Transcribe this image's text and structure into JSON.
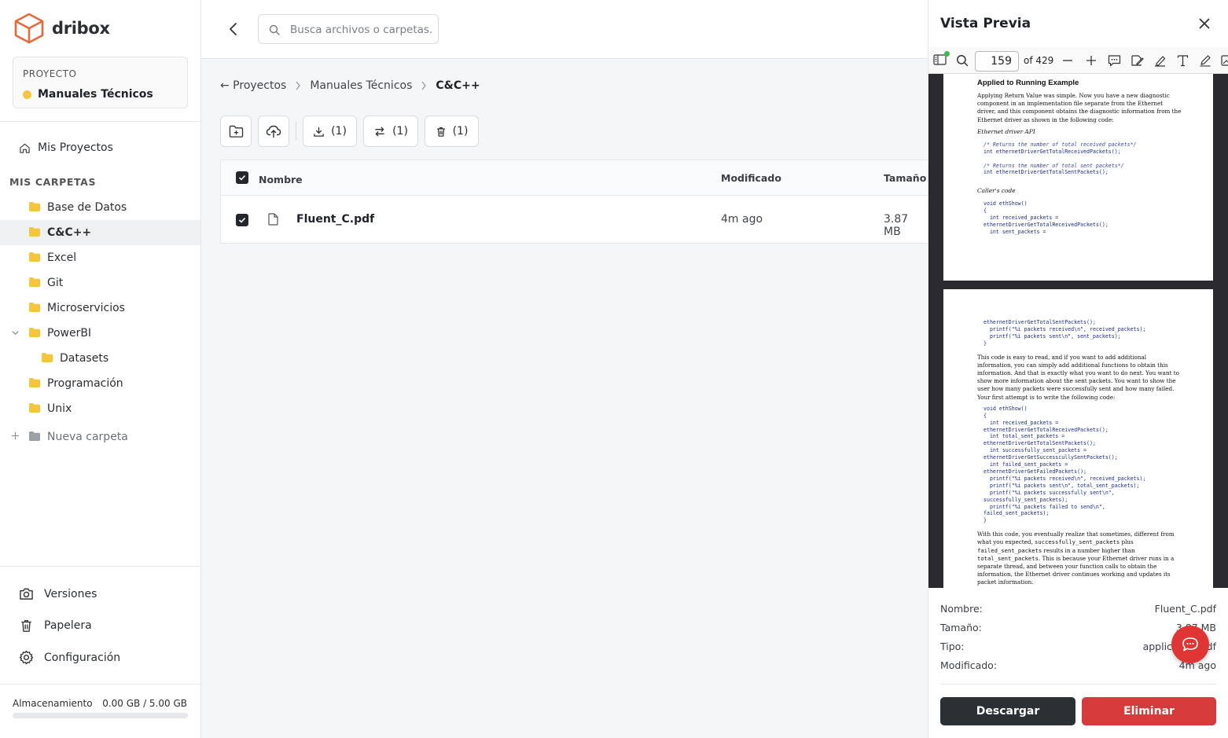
{
  "app": {
    "name": "dribox"
  },
  "project": {
    "label": "PROYECTO",
    "name": "Manuales Técnicos",
    "color": "#f5c542"
  },
  "nav": {
    "my_projects": "Mis Proyectos",
    "folders_title": "MIS CARPETAS"
  },
  "folders": [
    {
      "label": "Base de Datos"
    },
    {
      "label": "C&C++",
      "active": true
    },
    {
      "label": "Excel"
    },
    {
      "label": "Git"
    },
    {
      "label": "Microservicios"
    },
    {
      "label": "PowerBI",
      "expanded": true
    },
    {
      "label": "Datasets",
      "child": true
    },
    {
      "label": "Programación"
    },
    {
      "label": "Unix"
    }
  ],
  "new_folder": "Nueva carpeta",
  "bottom_nav": {
    "versions": "Versiones",
    "trash": "Papelera",
    "settings": "Configuración"
  },
  "storage": {
    "label": "Almacenamiento",
    "value": "0.00 GB / 5.00 GB",
    "fraction": 0.0
  },
  "search": {
    "placeholder": "Busca archivos o carpetas..."
  },
  "breadcrumb": {
    "root": "← Proyectos",
    "level1": "Manuales Técnicos",
    "current": "C&C++"
  },
  "toolbar": {
    "download_count": "(1)",
    "move_count": "(1)",
    "delete_count": "(1)"
  },
  "table": {
    "headers": {
      "name": "Nombre",
      "modified": "Modificado",
      "size": "Tamaño"
    },
    "rows": [
      {
        "name": "Fluent_C.pdf",
        "modified": "4m ago",
        "size": "3.87 MB",
        "checked": true
      }
    ]
  },
  "preview": {
    "title": "Vista Previa",
    "pdf": {
      "page": "159",
      "of": "of 429"
    },
    "page1": {
      "heading": "Applied to Running Example",
      "para": "Applying Return Value was simple. Now you have a new diagnostic component in an implementation file separate from the Ethernet driver, and this component obtains the diagnostic information from the Ethernet driver as shown in the following code:",
      "caption1": "Ethernet driver API",
      "comment1": "/* Returns the number of total received packets*/",
      "decl1": "int ethernetDriverGetTotalReceivedPackets();",
      "comment2": "/* Returns the number of total sent packets*/",
      "decl2": "int ethernetDriverGetTotalSentPackets();",
      "caption2": "Caller's code",
      "code_a": "void ethShow()",
      "code_b": "{",
      "code_c": "  int received_packets =",
      "code_d": "ethernetDriverGetTotalReceivedPackets();",
      "code_e": "  int sent_packets ="
    },
    "page2": {
      "code_a": "ethernetDriverGetTotalSentPackets();",
      "code_b": "  printf(\"%i packets received\\n\", received_packets);",
      "code_c": "  printf(\"%i packets sent\\n\", sent_packets);",
      "code_d": "}",
      "para1": "This code is easy to read, and if you want to add additional information, you can simply add additional functions to obtain this information. And that is exactly what you want to do next. You want to show more information about the sent packets. You want to show the user how many packets were successfully sent and how many failed. Your first attempt is to write the following code:",
      "code2": [
        "void ethShow()",
        "{",
        "  int received_packets =",
        "ethernetDriverGetTotalReceivedPackets();",
        "  int total_sent_packets =",
        "ethernetDriverGetTotalSentPackets();",
        "  int successfully_sent_packets =",
        "ethernetDriverGetSuccesscullySentPackets();",
        "  int failed_sent_packets =",
        "ethernetDriverGetFailedPackets();",
        "  printf(\"%i packets received\\n\", received_packets);",
        "  printf(\"%i packets sent\\n\", total_sent_packets);",
        "  printf(\"%i packets successfully sent\\n\",",
        "successfully_sent_packets);",
        "  printf(\"%i packets failed to send\\n\",",
        "failed_sent_packets);",
        "}"
      ],
      "p2_a": "With this code, you eventually realize that sometimes, different from what you expected, ",
      "p2_m1": "successfully_sent_packets",
      "p2_b": " plus ",
      "p2_m2": "failed_sent_packets",
      "p2_c": " results in a number higher than ",
      "p2_m3": "total_sent_packets",
      "p2_d": ". This is because your Ethernet driver runs in a separate thread, and between your function calls to obtain the information, the Ethernet driver continues working and updates its packet information."
    },
    "meta": {
      "name_label": "Nombre:",
      "name_value": "Fluent_C.pdf",
      "size_label": "Tamaño:",
      "size_value": "3.87 MB",
      "type_label": "Tipo:",
      "type_value": "application/pdf",
      "modified_label": "Modificado:",
      "modified_value": "4m ago"
    },
    "download": "Descargar",
    "delete": "Eliminar"
  },
  "colors": {
    "accent_dark": "#2b3035",
    "danger": "#d63b3b",
    "logo": "#e46a3d",
    "folder": "#f5c542"
  }
}
